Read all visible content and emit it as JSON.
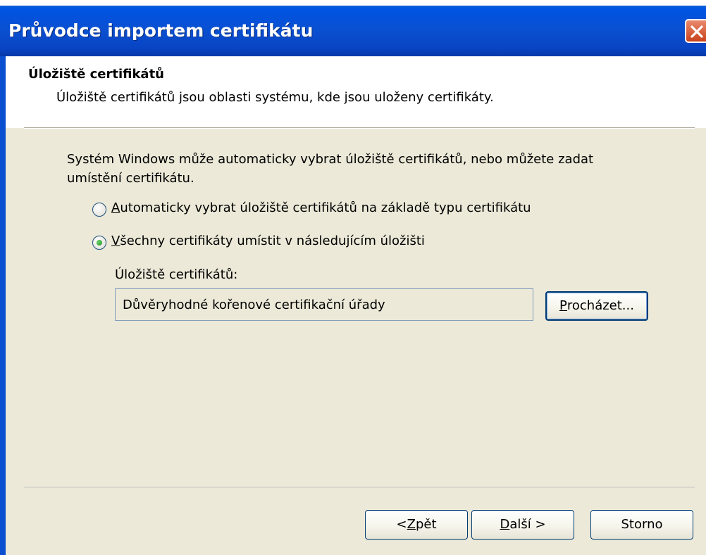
{
  "window": {
    "title": "Průvodce importem certifikátu"
  },
  "header": {
    "title": "Úložiště certifikátů",
    "subtitle": "Úložiště certifikátů jsou oblasti systému, kde jsou uloženy certifikáty."
  },
  "body": {
    "intro_line1": "Systém Windows může automaticky vybrat úložiště certifikátů, nebo můžete zadat",
    "intro_line2": "umístění certifikátu.",
    "radio_auto": {
      "mnemonic": "A",
      "label_rest": "utomaticky vybrat úložiště certifikátů na základě typu certifikátu",
      "selected": false
    },
    "radio_place": {
      "mnemonic": "V",
      "label_rest": "šechny certifikáty umístit v následujícím úložišti",
      "selected": true
    },
    "store_label": "Úložiště certifikátů:",
    "store_value": "Důvěryhodné kořenové certifikační úřady",
    "browse_button": {
      "mnemonic": "P",
      "rest": "rocházet..."
    }
  },
  "footer": {
    "back_button": {
      "prefix": "< ",
      "mnemonic": "Z",
      "rest": "pět"
    },
    "next_button": {
      "mnemonic": "D",
      "rest": "alší >"
    },
    "cancel_button": "Storno"
  },
  "icons": {
    "close": "close-icon",
    "radio": "radio-button-icon"
  },
  "colors": {
    "titlebar": "#0054e3",
    "dialog_background": "#ece9d8",
    "close_button": "#c9421c"
  }
}
